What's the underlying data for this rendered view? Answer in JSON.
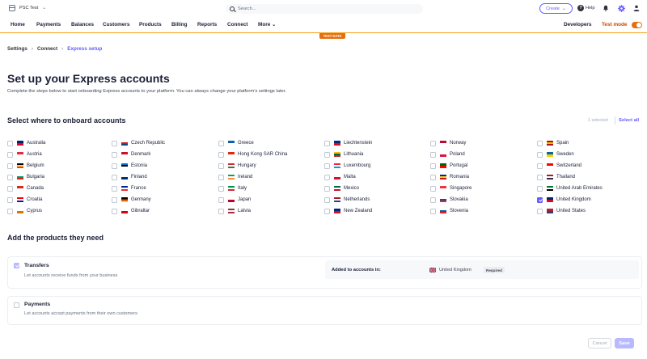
{
  "topbar": {
    "account_name": "PSC Test",
    "search_placeholder": "Search...",
    "create_label": "Create",
    "help_label": "Help"
  },
  "nav": {
    "items": [
      "Home",
      "Payments",
      "Balances",
      "Customers",
      "Products",
      "Billing",
      "Reports",
      "Connect",
      "More"
    ],
    "developers": "Developers",
    "test_mode": "Test mode",
    "test_mode_on": true,
    "test_data_badge": "TEST DATA"
  },
  "breadcrumb": [
    "Settings",
    "Connect",
    "Express setup"
  ],
  "page": {
    "title": "Set up your Express accounts",
    "subtitle": "Complete the steps below to start onboarding Express accounts to your platform. You can always change your platform’s settings later."
  },
  "countries_section": {
    "title": "Select where to onboard accounts",
    "selected_count": "1 selected",
    "select_all": "Select all",
    "columns": [
      [
        {
          "name": "Australia",
          "checked": false,
          "flag": [
            "#012169",
            "#e4002b"
          ]
        },
        {
          "name": "Austria",
          "checked": false,
          "flag": [
            "#ed2939",
            "#ffffff"
          ]
        },
        {
          "name": "Belgium",
          "checked": false,
          "flag": [
            "#000000",
            "#fdda24",
            "#ef3340"
          ]
        },
        {
          "name": "Bulgaria",
          "checked": false,
          "flag": [
            "#ffffff",
            "#00966e",
            "#d62612"
          ]
        },
        {
          "name": "Canada",
          "checked": false,
          "flag": [
            "#d52b1e",
            "#ffffff"
          ]
        },
        {
          "name": "Croatia",
          "checked": false,
          "flag": [
            "#ff0000",
            "#ffffff",
            "#171796"
          ]
        },
        {
          "name": "Cyprus",
          "checked": false,
          "flag": [
            "#ffffff",
            "#d57800"
          ]
        }
      ],
      [
        {
          "name": "Czech Republic",
          "checked": false,
          "flag": [
            "#ffffff",
            "#d7141a",
            "#11457e"
          ]
        },
        {
          "name": "Denmark",
          "checked": false,
          "flag": [
            "#c8102e",
            "#ffffff"
          ]
        },
        {
          "name": "Estonia",
          "checked": false,
          "flag": [
            "#0072ce",
            "#000000",
            "#ffffff"
          ]
        },
        {
          "name": "Finland",
          "checked": false,
          "flag": [
            "#ffffff",
            "#002f6c"
          ]
        },
        {
          "name": "France",
          "checked": false,
          "flag": [
            "#002395",
            "#ffffff",
            "#ed2939"
          ]
        },
        {
          "name": "Germany",
          "checked": false,
          "flag": [
            "#000000",
            "#dd0000",
            "#ffce00"
          ]
        },
        {
          "name": "Gibraltar",
          "checked": false,
          "flag": [
            "#ffffff",
            "#da000c"
          ]
        }
      ],
      [
        {
          "name": "Greece",
          "checked": false,
          "flag": [
            "#0d5eaf",
            "#ffffff"
          ]
        },
        {
          "name": "Hong Kong SAR China",
          "checked": false,
          "flag": [
            "#de2910",
            "#ffffff"
          ]
        },
        {
          "name": "Hungary",
          "checked": false,
          "flag": [
            "#ce2939",
            "#ffffff",
            "#477050"
          ]
        },
        {
          "name": "Ireland",
          "checked": false,
          "flag": [
            "#169b62",
            "#ffffff",
            "#ff883e"
          ]
        },
        {
          "name": "Italy",
          "checked": false,
          "flag": [
            "#009246",
            "#ffffff",
            "#ce2b37"
          ]
        },
        {
          "name": "Japan",
          "checked": false,
          "flag": [
            "#ffffff",
            "#bc002d"
          ]
        },
        {
          "name": "Latvia",
          "checked": false,
          "flag": [
            "#9e3039",
            "#ffffff",
            "#9e3039"
          ]
        }
      ],
      [
        {
          "name": "Liechtenstein",
          "checked": false,
          "flag": [
            "#002b7f",
            "#ce1126"
          ]
        },
        {
          "name": "Lithuania",
          "checked": false,
          "flag": [
            "#fdb913",
            "#006a44",
            "#c1272d"
          ]
        },
        {
          "name": "Luxembourg",
          "checked": false,
          "flag": [
            "#ed2939",
            "#ffffff",
            "#00a1de"
          ]
        },
        {
          "name": "Malta",
          "checked": false,
          "flag": [
            "#ffffff",
            "#cf142b"
          ]
        },
        {
          "name": "Mexico",
          "checked": false,
          "flag": [
            "#006847",
            "#ffffff",
            "#ce1126"
          ]
        },
        {
          "name": "Netherlands",
          "checked": false,
          "flag": [
            "#ae1c28",
            "#ffffff",
            "#21468b"
          ]
        },
        {
          "name": "New Zealand",
          "checked": false,
          "flag": [
            "#00247d",
            "#cc142b"
          ]
        }
      ],
      [
        {
          "name": "Norway",
          "checked": false,
          "flag": [
            "#ba0c2f",
            "#ffffff"
          ]
        },
        {
          "name": "Poland",
          "checked": false,
          "flag": [
            "#ffffff",
            "#dc143c"
          ]
        },
        {
          "name": "Portugal",
          "checked": false,
          "flag": [
            "#006600",
            "#ff0000"
          ]
        },
        {
          "name": "Romania",
          "checked": false,
          "flag": [
            "#002b7f",
            "#fcd116",
            "#ce1126"
          ]
        },
        {
          "name": "Singapore",
          "checked": false,
          "flag": [
            "#ef3340",
            "#ffffff"
          ]
        },
        {
          "name": "Slovakia",
          "checked": false,
          "flag": [
            "#ffffff",
            "#0b4ea2",
            "#ee1c25"
          ]
        },
        {
          "name": "Slovenia",
          "checked": false,
          "flag": [
            "#ffffff",
            "#005da4",
            "#ed1c24"
          ]
        }
      ],
      [
        {
          "name": "Spain",
          "checked": false,
          "flag": [
            "#aa151b",
            "#f1bf00",
            "#aa151b"
          ]
        },
        {
          "name": "Sweden",
          "checked": false,
          "flag": [
            "#006aa7",
            "#fecc00"
          ]
        },
        {
          "name": "Switzerland",
          "checked": false,
          "flag": [
            "#ff0000",
            "#ffffff"
          ]
        },
        {
          "name": "Thailand",
          "checked": false,
          "flag": [
            "#a51931",
            "#ffffff",
            "#2d2a4a"
          ]
        },
        {
          "name": "United Arab Emirates",
          "checked": false,
          "flag": [
            "#00732f",
            "#ffffff",
            "#000000"
          ]
        },
        {
          "name": "United Kingdom",
          "checked": true,
          "flag": [
            "#012169",
            "#c8102e"
          ]
        },
        {
          "name": "United States",
          "checked": false,
          "flag": [
            "#b22234",
            "#3c3b6e"
          ]
        }
      ]
    ]
  },
  "products_section": {
    "title": "Add the products they need",
    "transfers": {
      "title": "Transfers",
      "description": "Let accounts receive funds from your business",
      "checked": true,
      "added_label": "Added to accounts in:",
      "added_country": "United Kingdom",
      "required_badge": "Required"
    },
    "payments": {
      "title": "Payments",
      "description": "Let accounts accept payments from their own customers",
      "checked": false
    }
  },
  "footer": {
    "cancel_label": "Cancel",
    "save_label": "Save"
  },
  "colors": {
    "accent": "#635bff",
    "test_orange": "#e56f0f"
  }
}
